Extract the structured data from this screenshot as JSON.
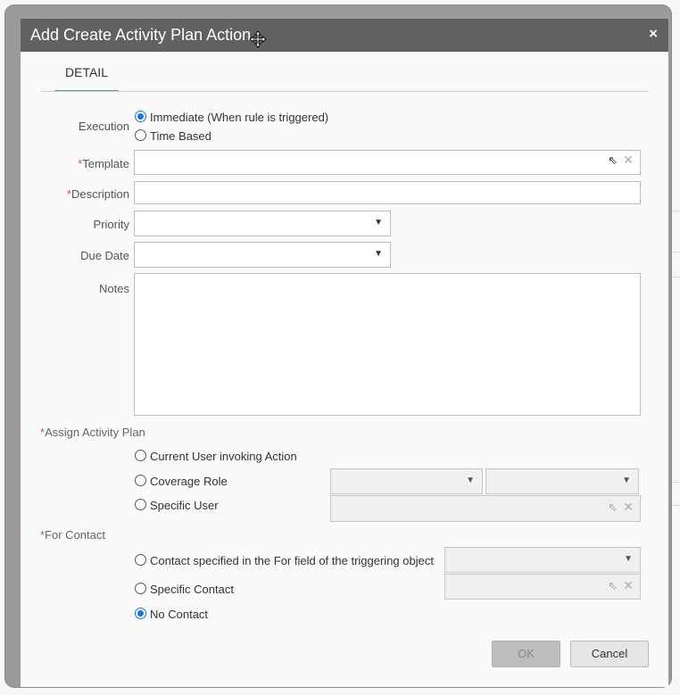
{
  "dialog": {
    "title": "Add Create Activity Plan Action",
    "close_glyph": "×"
  },
  "tabs": [
    {
      "label": "DETAIL",
      "active": true
    }
  ],
  "form": {
    "execution_label": "Execution",
    "execution_options": [
      "Immediate (When rule is triggered)",
      "Time Based"
    ],
    "execution_selected": "Immediate (When rule is triggered)",
    "template_label": "Template",
    "template_value": "",
    "description_label": "Description",
    "description_value": "",
    "priority_label": "Priority",
    "priority_value": "",
    "due_date_label": "Due Date",
    "due_date_value": "",
    "notes_label": "Notes",
    "notes_value": "",
    "required_marker": "*"
  },
  "assign": {
    "label": "Assign Activity Plan",
    "options": [
      "Current User invoking Action",
      "Coverage Role",
      "Specific User"
    ],
    "selected": null
  },
  "for_contact": {
    "label": "For Contact",
    "options": [
      "Contact specified in the For field of the triggering object",
      "Specific Contact",
      "No Contact"
    ],
    "selected": "No Contact"
  },
  "buttons": {
    "ok": "OK",
    "cancel": "Cancel"
  },
  "icons": {
    "caret": "▼",
    "lookup": "⇖",
    "clear": "✕",
    "move": "move-cursor-icon"
  },
  "colors": {
    "titlebar": "#616161",
    "tab_underline": "#4aa8a1",
    "required": "#d9534f",
    "radio_selected": "#1a73e8"
  }
}
